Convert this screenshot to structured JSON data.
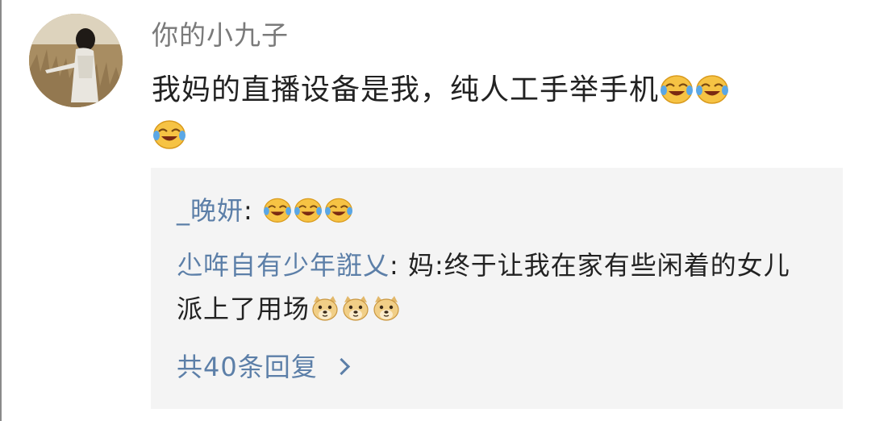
{
  "comment": {
    "username": "你的小九子",
    "text": "我妈的直播设备是我，纯人工手举手机",
    "emojis": [
      "laugh-cry-icon",
      "laugh-cry-icon",
      "laugh-cry-icon"
    ]
  },
  "replies": [
    {
      "author": "_晚妍",
      "separator": ": ",
      "text": "",
      "emojis": [
        "laugh-cry-icon",
        "laugh-cry-icon",
        "laugh-cry-icon"
      ]
    },
    {
      "author": "尐哖自有少年誑乂",
      "separator": ": ",
      "text": "妈:终于让我在家有些闲着的女儿派上了用场",
      "emojis": [
        "doge-icon",
        "doge-icon",
        "doge-icon"
      ]
    }
  ],
  "more_replies": {
    "label": "共40条回复"
  },
  "colors": {
    "username": "#7a7a7a",
    "link": "#5c7fa8",
    "text": "#222222",
    "reply_bg": "#f4f4f4"
  }
}
